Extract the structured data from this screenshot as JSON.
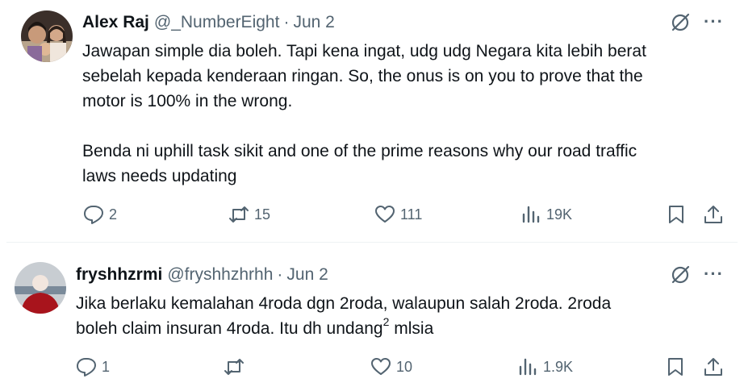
{
  "tweets": [
    {
      "author_name": "Alex Raj",
      "handle": "@_NumberEight",
      "separator": "·",
      "date": "Jun 2",
      "lines": [
        "Jawapan simple dia boleh. Tapi kena ingat, udg udg Negara kita lebih berat",
        "sebelah kepada kenderaan ringan. So, the onus is on you to prove that the",
        "motor is 100% in the wrong.",
        "Benda ni uphill task sikit and one of the prime reasons why our road traffic",
        "laws needs updating"
      ],
      "replies": "2",
      "reposts": "15",
      "likes": "111",
      "views": "19K"
    },
    {
      "author_name": "fryshhzrmi",
      "handle": "@fryshhzhrhh",
      "separator": "·",
      "date": "Jun 2",
      "line1": "Jika berlaku kemalahan 4roda dgn 2roda, walaupun salah 2roda. 2roda",
      "line2_main": "boleh claim insuran 4roda. Itu dh undang",
      "line2_sup": "2",
      "line2_end": " mlsia",
      "replies": "1",
      "reposts": "",
      "likes": "10",
      "views": "1.9K"
    }
  ],
  "more_label": "···",
  "colors": {
    "text": "#0f1419",
    "secondary": "#536471",
    "divider": "#eff3f4"
  }
}
